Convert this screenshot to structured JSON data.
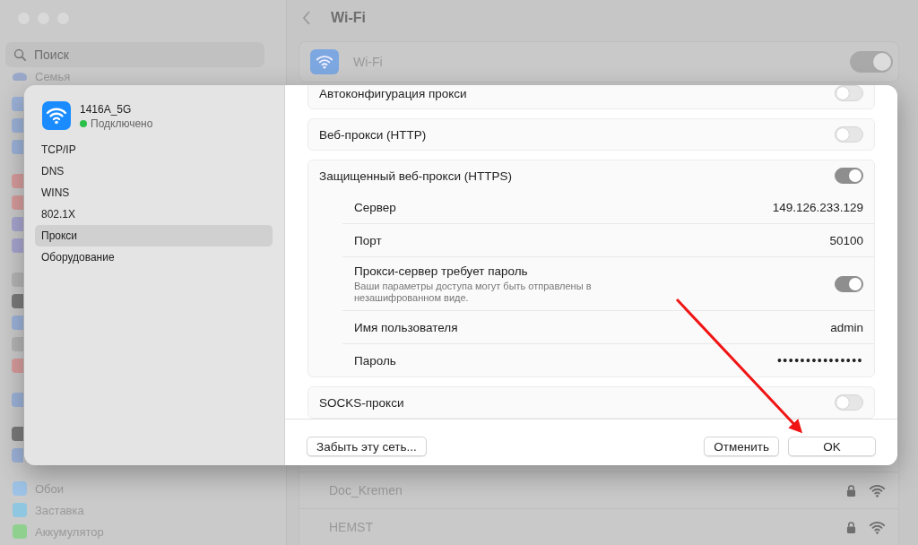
{
  "sidebar": {
    "search": {
      "placeholder": "Поиск"
    },
    "top_items": [
      {
        "label": "Семья"
      }
    ],
    "bottom_items": [
      {
        "label": "Обои",
        "color": "#9ec3e6"
      },
      {
        "label": "Заставка",
        "color": "#8fc6e0"
      },
      {
        "label": "Аккумулятор",
        "color": "#8fd08f"
      }
    ]
  },
  "main": {
    "title": "Wi-Fi",
    "wifi": {
      "label": "Wi-Fi",
      "on": true
    },
    "networks": [
      {
        "name": "Doc_Kremen",
        "locked": true
      },
      {
        "name": "HEMST",
        "locked": true
      }
    ]
  },
  "dialog": {
    "network": {
      "name": "1416A_5G",
      "status": "Подключено",
      "connected": true
    },
    "tabs": [
      {
        "label": "TCP/IP",
        "selected": false
      },
      {
        "label": "DNS",
        "selected": false
      },
      {
        "label": "WINS",
        "selected": false
      },
      {
        "label": "802.1X",
        "selected": false
      },
      {
        "label": "Прокси",
        "selected": true
      },
      {
        "label": "Оборудование",
        "selected": false
      }
    ],
    "proxies": [
      {
        "label": "Автоконфигурация прокси",
        "on": false
      },
      {
        "label": "Веб-прокси (HTTP)",
        "on": false
      },
      {
        "label": "Защищенный веб-прокси (HTTPS)",
        "on": true,
        "fields": [
          {
            "kind": "value",
            "label": "Сервер",
            "value": "149.126.233.129"
          },
          {
            "kind": "value",
            "label": "Порт",
            "value": "50100"
          },
          {
            "kind": "toggle",
            "label": "Прокси-сервер требует пароль",
            "note": "Ваши параметры доступа могут быть отправлены в незашифрованном виде.",
            "on": true
          },
          {
            "kind": "value",
            "label": "Имя пользователя",
            "value": "admin"
          },
          {
            "kind": "secret",
            "label": "Пароль",
            "value": "•••••••••••••••"
          }
        ]
      },
      {
        "label": "SOCKS-прокси",
        "on": false
      }
    ],
    "buttons": [
      {
        "label": "Забыть эту сеть...",
        "kind": "left"
      },
      {
        "label": "Отменить",
        "kind": "right"
      },
      {
        "label": "OK",
        "kind": "right"
      }
    ]
  }
}
